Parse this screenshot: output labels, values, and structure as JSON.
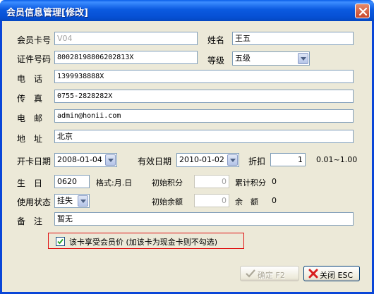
{
  "window": {
    "title": "会员信息管理[修改]"
  },
  "fields": {
    "card_no_label": "会员卡号",
    "card_no_value": "V04",
    "name_label": "姓名",
    "name_value": "王五",
    "id_label": "证件号码",
    "id_value": "80028198806202813X",
    "level_label": "等级",
    "level_value": "五级",
    "phone_label": "电　话",
    "phone_value": "1399938888X",
    "fax_label": "传　真",
    "fax_value": "0755-2828282X",
    "email_label": "电　邮",
    "email_value": "admin@honii.com",
    "address_label": "地　址",
    "address_value": "北京",
    "open_date_label": "开卡日期",
    "open_date_value": "2008-01-04",
    "valid_date_label": "有效日期",
    "valid_date_value": "2010-01-02",
    "discount_label": "折扣",
    "discount_value": "1",
    "discount_range": "0.01~1.00",
    "birthday_label": "生　日",
    "birthday_value": "0620",
    "birthday_format": "格式:月.日",
    "init_points_label": "初始积分",
    "init_points_value": "0",
    "total_points_label": "累计积分",
    "total_points_value": "0",
    "status_label": "使用状态",
    "status_value": "挂失",
    "init_balance_label": "初始余额",
    "init_balance_value": "0",
    "balance_label": "余　额",
    "balance_value": "0",
    "remark_label": "备　注",
    "remark_value": "暂无"
  },
  "checkbox": {
    "label": "该卡享受会员价 (加该卡为现金卡则不勾选)",
    "checked": true
  },
  "buttons": {
    "ok_label": "确定 F2",
    "close_label": "关闭 ESC"
  },
  "colors": {
    "titlebar": "#0a5fe9",
    "dialog_bg": "#ece9d8",
    "input_border": "#7f9db9",
    "highlight_border": "#e01010"
  },
  "icons": {
    "close_window": "close-icon",
    "ok": "checkmark-icon",
    "close_button": "red-x-icon"
  }
}
